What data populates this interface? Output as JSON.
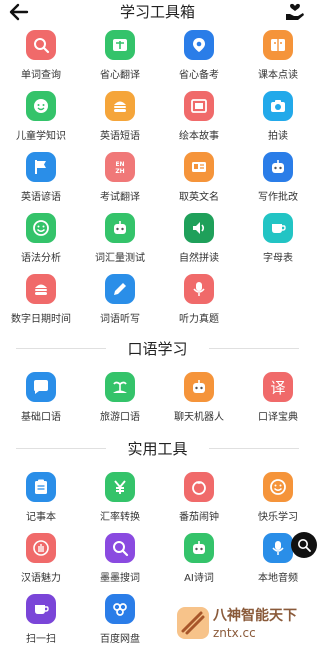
{
  "header": {
    "title": "学习工具箱"
  },
  "sections": [
    {
      "title": ""
    },
    {
      "title": "口语学习"
    },
    {
      "title": "实用工具"
    }
  ],
  "tools_main": [
    {
      "label": "单词查询",
      "color": "#f06a6a",
      "icon": "search-icon"
    },
    {
      "label": "省心翻译",
      "color": "#34c36a",
      "icon": "translate-icon"
    },
    {
      "label": "省心备考",
      "color": "#2a7de8",
      "icon": "pin-icon"
    },
    {
      "label": "课本点读",
      "color": "#f5943a",
      "icon": "book-icon"
    },
    {
      "label": "儿童学知识",
      "color": "#34c36a",
      "icon": "face-icon"
    },
    {
      "label": "英语短语",
      "color": "#f5a53a",
      "icon": "burger-icon"
    },
    {
      "label": "绘本故事",
      "color": "#f06a6a",
      "icon": "picturebook-icon"
    },
    {
      "label": "拍读",
      "color": "#22a9ea",
      "icon": "camera-icon"
    },
    {
      "label": "英语谚语",
      "color": "#2a8ee8",
      "icon": "flag-icon"
    },
    {
      "label": "考试翻译",
      "color": "#f07878",
      "icon": "en-zh-icon"
    },
    {
      "label": "取英文名",
      "color": "#f5943a",
      "icon": "id-card-icon"
    },
    {
      "label": "写作批改",
      "color": "#2a7de8",
      "icon": "robot-icon"
    },
    {
      "label": "语法分析",
      "color": "#34c36a",
      "icon": "smile-icon"
    },
    {
      "label": "词汇量测试",
      "color": "#34c36a",
      "icon": "robot-icon"
    },
    {
      "label": "自然拼读",
      "color": "#1fa05a",
      "icon": "speaker-icon"
    },
    {
      "label": "字母表",
      "color": "#22c4c4",
      "icon": "cup-icon"
    },
    {
      "label": "数字日期时间",
      "color": "#f06a6a",
      "icon": "burger-icon"
    },
    {
      "label": "词语听写",
      "color": "#2a8ee8",
      "icon": "pencil-icon"
    },
    {
      "label": "听力真题",
      "color": "#f06a6a",
      "icon": "mic-icon"
    }
  ],
  "tools_speaking": [
    {
      "label": "基础口语",
      "color": "#2a8ee8",
      "icon": "chat-icon"
    },
    {
      "label": "旅游口语",
      "color": "#34c36a",
      "icon": "island-icon"
    },
    {
      "label": "聊天机器人",
      "color": "#f5943a",
      "icon": "robot-icon"
    },
    {
      "label": "口译宝典",
      "color": "#f06a6a",
      "icon": "yi-icon",
      "text": "译"
    }
  ],
  "tools_utility": [
    {
      "label": "记事本",
      "color": "#2a8ee8",
      "icon": "clipboard-icon"
    },
    {
      "label": "汇率转换",
      "color": "#34c36a",
      "icon": "yen-icon"
    },
    {
      "label": "番茄闹钟",
      "color": "#f06a6a",
      "icon": "tomato-icon"
    },
    {
      "label": "快乐学习",
      "color": "#f5943a",
      "icon": "smile-icon"
    },
    {
      "label": "汉语魅力",
      "color": "#f06a6a",
      "icon": "hand-icon"
    },
    {
      "label": "墨墨搜词",
      "color": "#8a4ae0",
      "icon": "search-icon"
    },
    {
      "label": "AI诗词",
      "color": "#34c36a",
      "icon": "robot-icon"
    },
    {
      "label": "本地音频",
      "color": "#2a8ee8",
      "icon": "mic-icon"
    },
    {
      "label": "扫一扫",
      "color": "#7a45d8",
      "icon": "cup-icon"
    },
    {
      "label": "百度网盘",
      "color": "#2a7de8",
      "icon": "cloud-icon"
    }
  ],
  "watermark": {
    "line1": "八神智能天下",
    "line2": "zntx.cc"
  }
}
